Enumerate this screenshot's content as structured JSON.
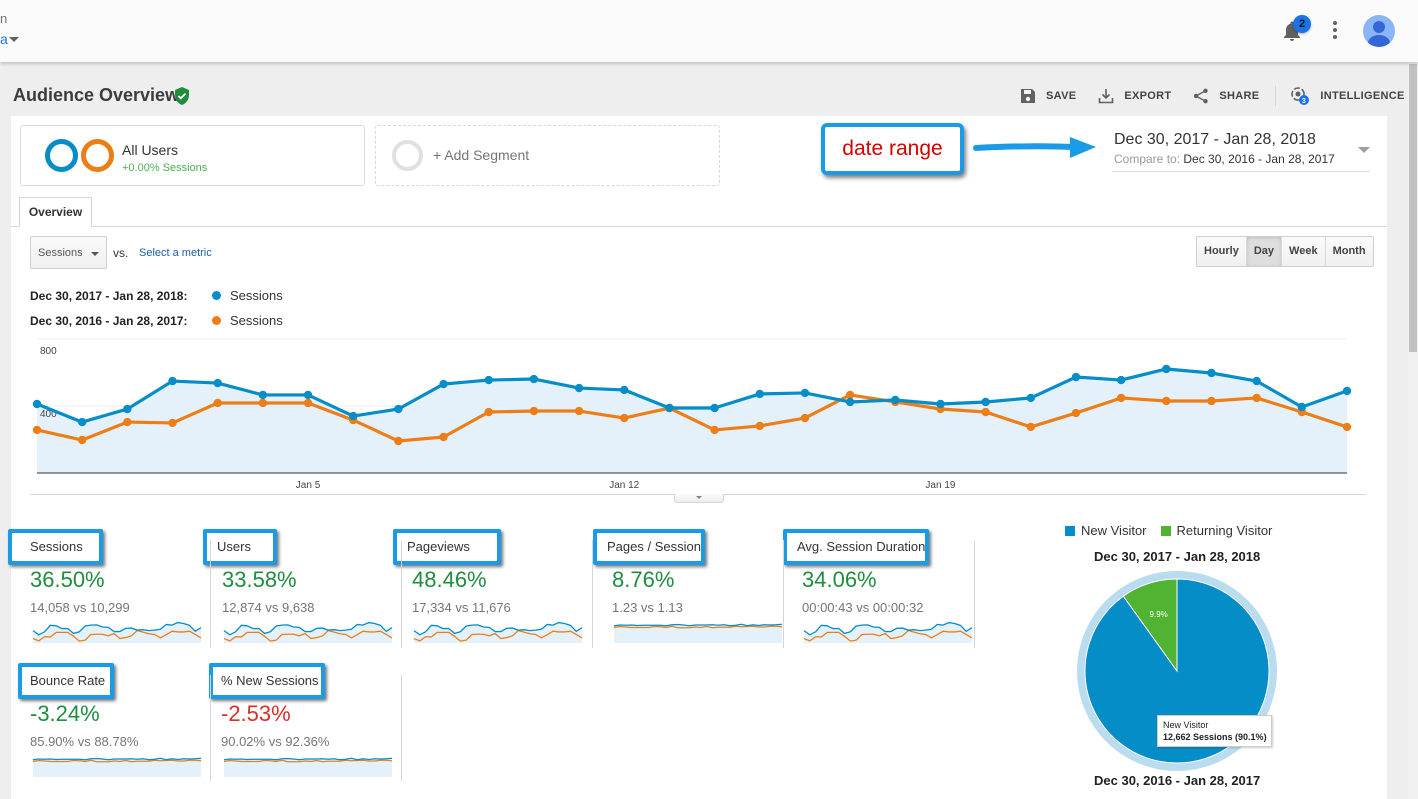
{
  "topbar": {
    "account_label": "n",
    "view_label": "a",
    "notification_count": "2",
    "icons": {
      "bell": "bell-icon",
      "more": "more-vert-icon",
      "avatar": "account-avatar-icon"
    }
  },
  "header": {
    "title": "Audience Overview",
    "verified_icon": "verified-shield-icon",
    "actions": [
      {
        "label": "SAVE",
        "icon": "save-icon"
      },
      {
        "label": "EXPORT",
        "icon": "export-icon"
      },
      {
        "label": "SHARE",
        "icon": "share-icon"
      },
      {
        "label": "INTELLIGENCE",
        "icon": "intelligence-icon",
        "badge": "3"
      }
    ]
  },
  "segments": {
    "all_users": {
      "title": "All Users",
      "subtitle": "+0.00% Sessions"
    },
    "add_segment": {
      "label": "+ Add Segment"
    }
  },
  "annotation": {
    "label": "date range"
  },
  "date_range": {
    "main": "Dec 30, 2017 - Jan 28, 2018",
    "compare_label": "Compare to:",
    "compare_range": "Dec 30, 2016 - Jan 28, 2017"
  },
  "tabs": [
    {
      "label": "Overview",
      "active": true
    }
  ],
  "controls": {
    "metric_select": "Sessions",
    "vs_label": "vs.",
    "select_metric_link": "Select a metric",
    "granularity": [
      {
        "label": "Hourly",
        "active": false
      },
      {
        "label": "Day",
        "active": true
      },
      {
        "label": "Week",
        "active": false
      },
      {
        "label": "Month",
        "active": false
      }
    ]
  },
  "chart_legend": [
    {
      "range": "Dec 30, 2017 - Jan 28, 2018:",
      "metric": "Sessions",
      "color": "#058dc7"
    },
    {
      "range": "Dec 30, 2016 - Jan 28, 2017:",
      "metric": "Sessions",
      "color": "#ed7e17"
    }
  ],
  "chart_data": {
    "type": "line",
    "title": "",
    "xlabel": "",
    "ylabel": "Sessions",
    "ylim": [
      0,
      800
    ],
    "yticks": [
      400,
      800
    ],
    "ytick_labels": [
      "400",
      "800"
    ],
    "x_tick_labels": [
      {
        "index": 6,
        "label": "Jan 5"
      },
      {
        "index": 13,
        "label": "Jan 12"
      },
      {
        "index": 20,
        "label": "Jan 19"
      }
    ],
    "x": [
      "Dec 30",
      "Dec 31",
      "Jan 1",
      "Jan 2",
      "Jan 3",
      "Jan 4",
      "Jan 5",
      "Jan 6",
      "Jan 7",
      "Jan 8",
      "Jan 9",
      "Jan 10",
      "Jan 11",
      "Jan 12",
      "Jan 13",
      "Jan 14",
      "Jan 15",
      "Jan 16",
      "Jan 17",
      "Jan 18",
      "Jan 19",
      "Jan 20",
      "Jan 21",
      "Jan 22",
      "Jan 23",
      "Jan 24",
      "Jan 25",
      "Jan 26",
      "Jan 27",
      "Jan 28"
    ],
    "grid": true,
    "series": [
      {
        "name": "Sessions (Dec 30, 2017 - Jan 28, 2018)",
        "color": "#058dc7",
        "filled": true,
        "values": [
          412,
          304,
          382,
          549,
          537,
          466,
          466,
          340,
          382,
          531,
          555,
          561,
          507,
          496,
          388,
          388,
          472,
          478,
          424,
          436,
          412,
          424,
          448,
          573,
          555,
          621,
          597,
          549,
          394,
          490
        ]
      },
      {
        "name": "Sessions (Dec 30, 2016 - Jan 28, 2017)",
        "color": "#ed7e17",
        "filled": false,
        "values": [
          257,
          197,
          304,
          299,
          418,
          418,
          418,
          316,
          191,
          215,
          364,
          370,
          370,
          328,
          388,
          257,
          281,
          328,
          466,
          424,
          382,
          364,
          275,
          358,
          448,
          430,
          430,
          448,
          364,
          275
        ]
      }
    ]
  },
  "metrics": [
    {
      "label": "Sessions",
      "change": "36.50%",
      "positive": true,
      "compare": "14,058 vs 10,299"
    },
    {
      "label": "Users",
      "change": "33.58%",
      "positive": true,
      "compare": "12,874 vs 9,638"
    },
    {
      "label": "Pageviews",
      "change": "48.46%",
      "positive": true,
      "compare": "17,334 vs 11,676"
    },
    {
      "label": "Pages / Session",
      "change": "8.76%",
      "positive": true,
      "compare": "1.23 vs 1.13"
    },
    {
      "label": "Avg. Session Duration",
      "change": "34.06%",
      "positive": true,
      "compare": "00:00:43 vs 00:00:32"
    },
    {
      "label": "Bounce Rate",
      "change": "-3.24%",
      "positive": true,
      "compare": "85.90% vs 88.78%"
    },
    {
      "label": "% New Sessions",
      "change": "-2.53%",
      "positive": false,
      "compare": "90.02% vs 92.36%"
    }
  ],
  "pie": {
    "legend": [
      {
        "label": "New Visitor",
        "color": "#058dc7"
      },
      {
        "label": "Returning Visitor",
        "color": "#50b432"
      }
    ],
    "title_current": "Dec 30, 2017 - Jan 28, 2018",
    "title_previous": "Dec 30, 2016 - Jan 28, 2017",
    "slices": [
      {
        "label": "New Visitor",
        "percent": 90.1
      },
      {
        "label": "Returning Visitor",
        "percent": 9.9,
        "display": "9.9%"
      }
    ],
    "tooltip": {
      "title": "New Visitor",
      "value": "12,662 Sessions (90.1%)"
    }
  }
}
